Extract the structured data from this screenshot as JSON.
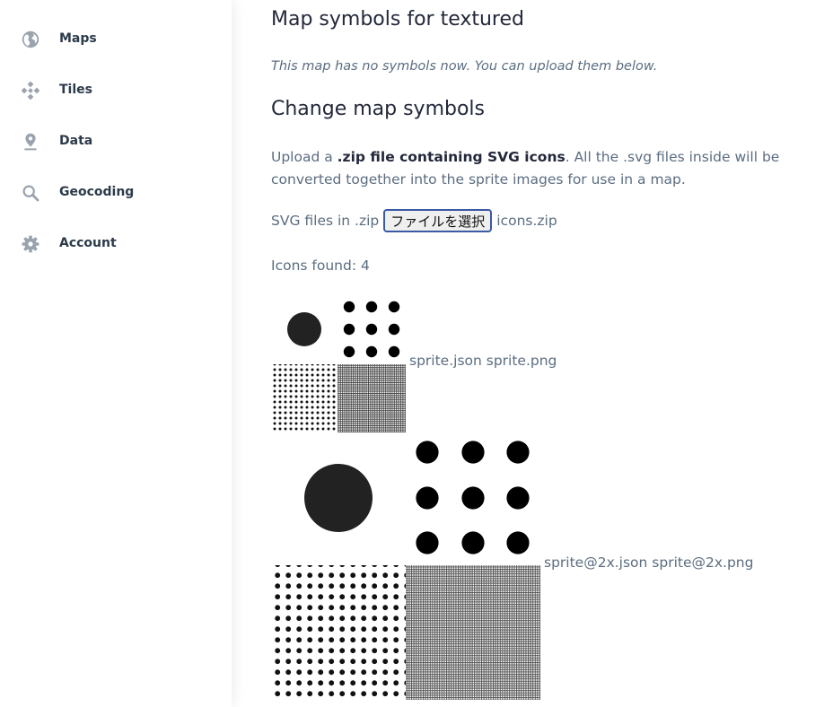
{
  "sidebar": {
    "items": [
      {
        "label": "Maps",
        "icon": "globe-icon"
      },
      {
        "label": "Tiles",
        "icon": "tiles-icon"
      },
      {
        "label": "Data",
        "icon": "location-pin-icon"
      },
      {
        "label": "Geocoding",
        "icon": "search-icon"
      },
      {
        "label": "Account",
        "icon": "gear-icon"
      }
    ]
  },
  "main": {
    "title": "Map symbols for textured",
    "no_symbols_note": "This map has no symbols now. You can upload them below.",
    "change_heading": "Change map symbols",
    "description": {
      "prefix": "Upload a ",
      "bold": ".zip file containing SVG icons",
      "suffix": ". All the .svg files inside will be converted together into the sprite images for use in a map."
    },
    "upload": {
      "label": "SVG files in .zip",
      "button_label": "ファイルを選択",
      "file_name": "icons.zip"
    },
    "icons_found": "Icons found: 4",
    "sprites": [
      {
        "files": "sprite.json sprite.png"
      },
      {
        "files": "sprite@2x.json sprite@2x.png"
      }
    ]
  },
  "colors": {
    "heading": "#23283a",
    "body_text": "#5b6d80",
    "nav_text": "#2c3a4a",
    "nav_icon": "#9aa3ae",
    "file_button_border": "#3b5aa4",
    "sprite_fill": "#222222"
  }
}
